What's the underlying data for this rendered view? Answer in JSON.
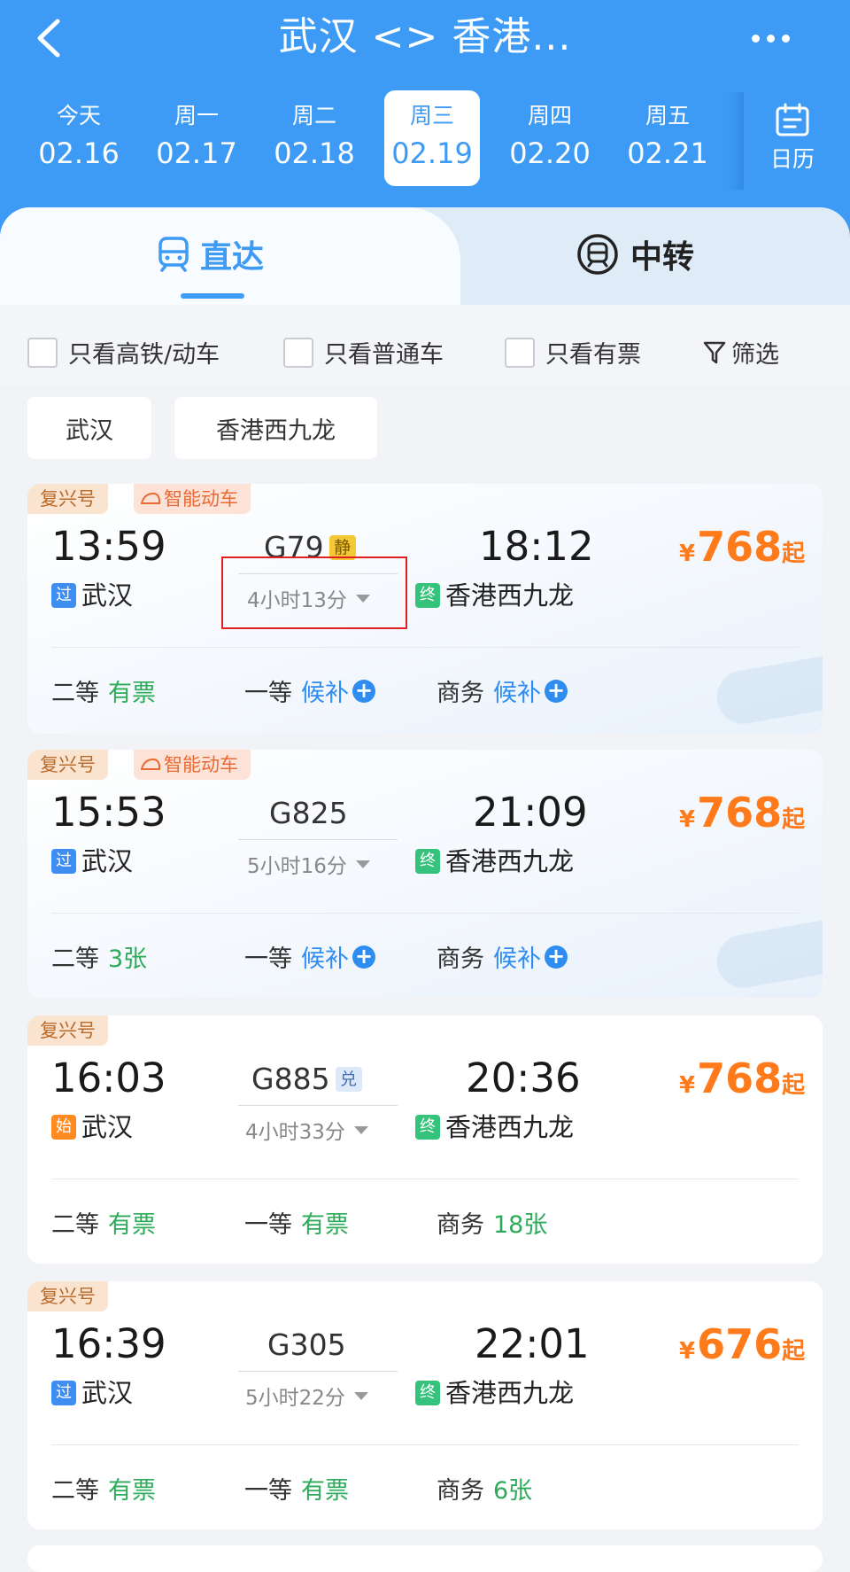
{
  "header": {
    "title": "武汉 <> 香港...",
    "dates": [
      {
        "weekday": "今天",
        "date": "02.16",
        "active": false
      },
      {
        "weekday": "周一",
        "date": "02.17",
        "active": false
      },
      {
        "weekday": "周二",
        "date": "02.18",
        "active": false
      },
      {
        "weekday": "周三",
        "date": "02.19",
        "active": true
      },
      {
        "weekday": "周四",
        "date": "02.20",
        "active": false
      },
      {
        "weekday": "周五",
        "date": "02.21",
        "active": false
      }
    ],
    "calendar_label": "日历"
  },
  "tabs": {
    "direct": "直达",
    "transfer": "中转"
  },
  "filters": {
    "high_speed": "只看高铁/动车",
    "normal": "只看普通车",
    "available": "只看有票",
    "filter": "筛选"
  },
  "chips": {
    "from": "武汉",
    "to": "香港西九龙"
  },
  "trains": [
    {
      "badges": [
        "复兴号",
        "智能动车"
      ],
      "depart_time": "13:59",
      "depart_tag": "过",
      "depart_station": "武汉",
      "train_no": "G79",
      "train_tag": "静",
      "duration": "4小时13分",
      "arrive_time": "18:12",
      "arrive_tag": "终",
      "arrive_station": "香港西九龙",
      "price_symbol": "¥",
      "price": "768",
      "price_suffix": "起",
      "seats": [
        {
          "class": "二等",
          "status": "有票"
        },
        {
          "class": "一等",
          "status": "候补"
        },
        {
          "class": "商务",
          "status": "候补"
        }
      ]
    },
    {
      "badges": [
        "复兴号",
        "智能动车"
      ],
      "depart_time": "15:53",
      "depart_tag": "过",
      "depart_station": "武汉",
      "train_no": "G825",
      "train_tag": "",
      "duration": "5小时16分",
      "arrive_time": "21:09",
      "arrive_tag": "终",
      "arrive_station": "香港西九龙",
      "price_symbol": "¥",
      "price": "768",
      "price_suffix": "起",
      "seats": [
        {
          "class": "二等",
          "status": "3张"
        },
        {
          "class": "一等",
          "status": "候补"
        },
        {
          "class": "商务",
          "status": "候补"
        }
      ]
    },
    {
      "badges": [
        "复兴号"
      ],
      "depart_time": "16:03",
      "depart_tag": "始",
      "depart_station": "武汉",
      "train_no": "G885",
      "train_tag": "兑",
      "duration": "4小时33分",
      "arrive_time": "20:36",
      "arrive_tag": "终",
      "arrive_station": "香港西九龙",
      "price_symbol": "¥",
      "price": "768",
      "price_suffix": "起",
      "seats": [
        {
          "class": "二等",
          "status": "有票"
        },
        {
          "class": "一等",
          "status": "有票"
        },
        {
          "class": "商务",
          "status": "18张"
        }
      ]
    },
    {
      "badges": [
        "复兴号"
      ],
      "depart_time": "16:39",
      "depart_tag": "过",
      "depart_station": "武汉",
      "train_no": "G305",
      "train_tag": "",
      "duration": "5小时22分",
      "arrive_time": "22:01",
      "arrive_tag": "终",
      "arrive_station": "香港西九龙",
      "price_symbol": "¥",
      "price": "676",
      "price_suffix": "起",
      "seats": [
        {
          "class": "二等",
          "status": "有票"
        },
        {
          "class": "一等",
          "status": "有票"
        },
        {
          "class": "商务",
          "status": "6张"
        }
      ]
    }
  ],
  "colors": {
    "primary": "#3d9bf5",
    "price": "#ff7a1a",
    "available": "#2eab5a",
    "waitlist": "#2f8cf0",
    "tag_pass": "#3d8ef0",
    "tag_start": "#ff8a1f",
    "tag_end": "#35c27a"
  }
}
